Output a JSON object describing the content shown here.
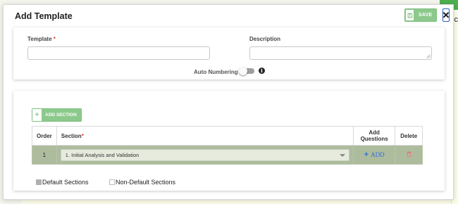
{
  "background": {
    "partial_text": "ic"
  },
  "modal": {
    "title": "Add Template",
    "save_label": "SAVE",
    "close_glyph": "✕",
    "save_icon": "save-icon",
    "close_icon": "close-icon"
  },
  "form": {
    "template_label": "Template",
    "required_mark": "*",
    "template_value": "",
    "description_label": "Description",
    "description_value": "",
    "auto_numbering_label": "Auto Numbering :",
    "auto_numbering_on": false,
    "info_glyph": "i"
  },
  "sections": {
    "add_section_label": "ADD SECTION",
    "add_section_icon": "plus-icon",
    "columns": {
      "order": "Order",
      "section": "Section",
      "add_questions": "Add Questions",
      "delete": "Delete"
    },
    "rows": [
      {
        "order": "1",
        "section": "1. Initial Analysis and Validation",
        "add_label": "ADD"
      }
    ],
    "legend": {
      "default": "Default Sections",
      "non_default": "Non-Default Sections"
    }
  },
  "colors": {
    "accent_green": "#8cc98c",
    "default_row": "#aebc9e",
    "link_blue": "#2f6fd6",
    "required_red": "#e53935"
  }
}
